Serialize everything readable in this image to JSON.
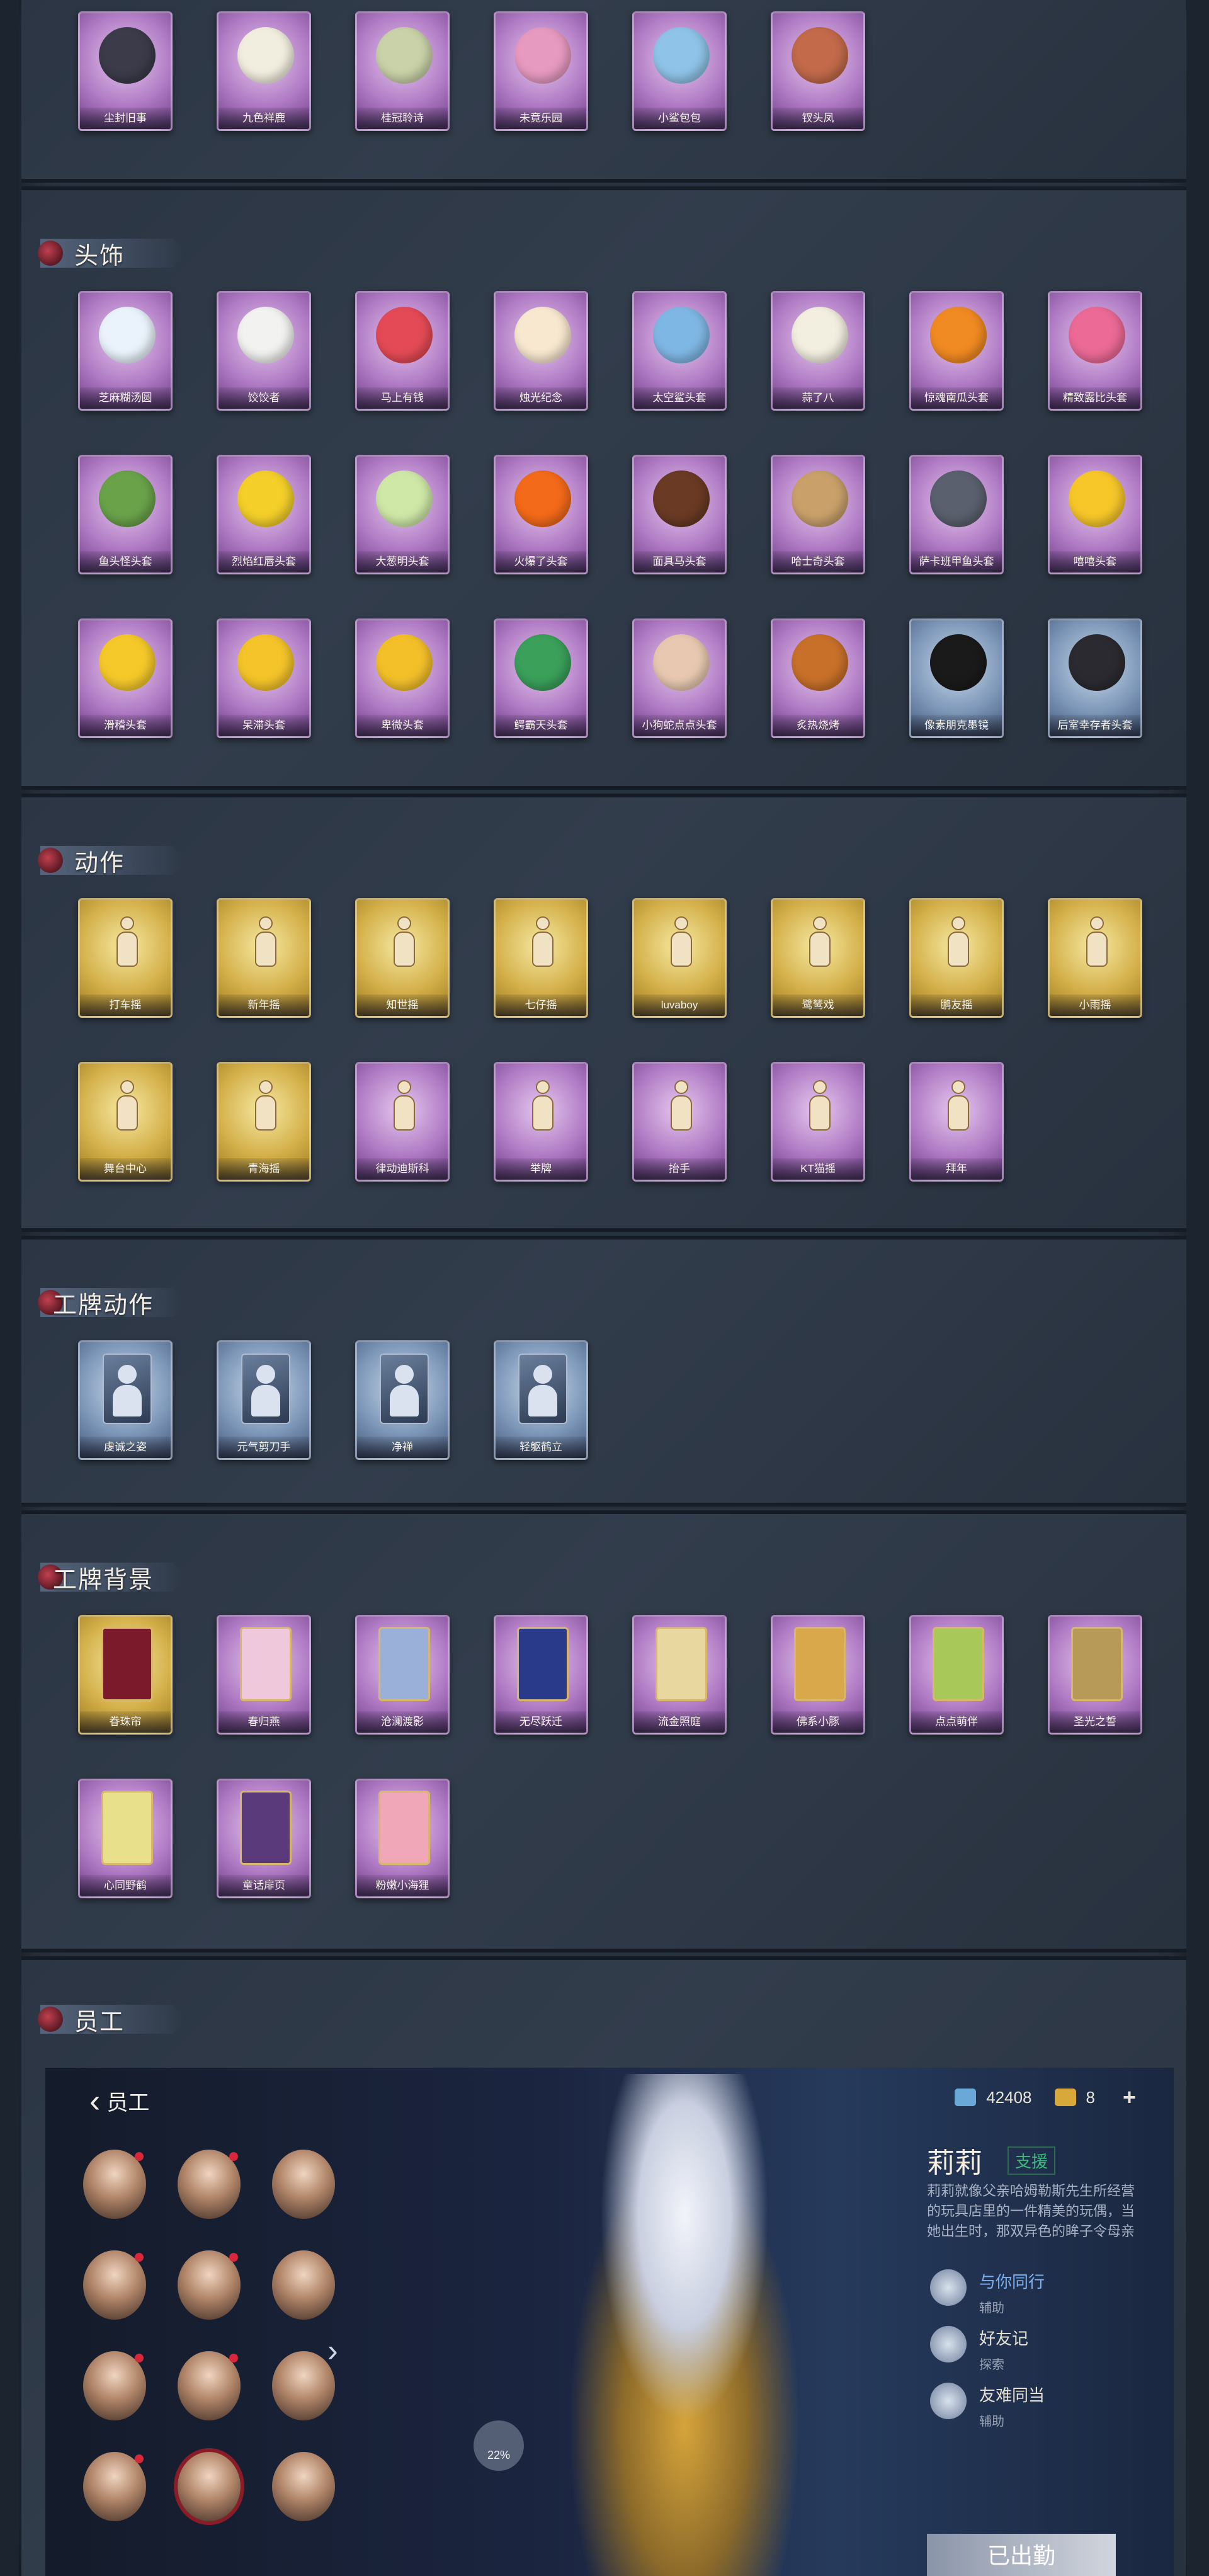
{
  "sections": {
    "s0": {
      "items": [
        {
          "label": "尘封旧事",
          "c": "purple",
          "pc": "#3b3b4a"
        },
        {
          "label": "九色祥鹿",
          "c": "purple",
          "pc": "#f1eedf"
        },
        {
          "label": "桂冠聆诗",
          "c": "purple",
          "pc": "#c9d2a8"
        },
        {
          "label": "未竟乐园",
          "c": "purple",
          "pc": "#e79ac0"
        },
        {
          "label": "小鲨包包",
          "c": "purple",
          "pc": "#8fc3e8"
        },
        {
          "label": "钗头凤",
          "c": "purple",
          "pc": "#c26a4a"
        }
      ]
    },
    "s1": {
      "title": "头饰",
      "items": [
        {
          "label": "芝麻糊汤圆",
          "c": "purple",
          "pc": "#eaf3fb"
        },
        {
          "label": "饺饺者",
          "c": "purple",
          "pc": "#f2f2f0"
        },
        {
          "label": "马上有钱",
          "c": "purple",
          "pc": "#e44a55"
        },
        {
          "label": "烛光纪念",
          "c": "purple",
          "pc": "#f8e8d0"
        },
        {
          "label": "太空鲨头套",
          "c": "purple",
          "pc": "#7fb7e4"
        },
        {
          "label": "蒜了八",
          "c": "purple",
          "pc": "#f2eee0"
        },
        {
          "label": "惊魂南瓜头套",
          "c": "purple",
          "pc": "#f08a22"
        },
        {
          "label": "精致露比头套",
          "c": "purple",
          "pc": "#ec6a96"
        },
        {
          "label": "鱼头怪头套",
          "c": "purple",
          "pc": "#6aa24a"
        },
        {
          "label": "烈焰红唇头套",
          "c": "purple",
          "pc": "#f4cf2a"
        },
        {
          "label": "大葱明头套",
          "c": "purple",
          "pc": "#cfe8a8"
        },
        {
          "label": "火爆了头套",
          "c": "purple",
          "pc": "#f36a1a"
        },
        {
          "label": "面具马头套",
          "c": "purple",
          "pc": "#6a3a24"
        },
        {
          "label": "哈士奇头套",
          "c": "purple",
          "pc": "#c9a06a"
        },
        {
          "label": "萨卡班甲鱼头套",
          "c": "purple",
          "pc": "#5a606e"
        },
        {
          "label": "嘻嘻头套",
          "c": "purple",
          "pc": "#f7c72a"
        },
        {
          "label": "滑稽头套",
          "c": "purple",
          "pc": "#f5c92a"
        },
        {
          "label": "呆滞头套",
          "c": "purple",
          "pc": "#f4c42a"
        },
        {
          "label": "卑微头套",
          "c": "purple",
          "pc": "#f3c02a"
        },
        {
          "label": "鳄霸天头套",
          "c": "purple",
          "pc": "#3aa05a"
        },
        {
          "label": "小狗蛇点点头套",
          "c": "purple",
          "pc": "#e8c8b0"
        },
        {
          "label": "炙热烧烤",
          "c": "purple",
          "pc": "#c8702a"
        },
        {
          "label": "像素朋克墨镜",
          "c": "blue",
          "pc": "#1a1a1a"
        },
        {
          "label": "后室幸存者头套",
          "c": "blue",
          "pc": "#2a2a30"
        }
      ]
    },
    "s2": {
      "title": "动作",
      "items": [
        {
          "label": "打车摇",
          "c": "gold"
        },
        {
          "label": "新年摇",
          "c": "gold"
        },
        {
          "label": "知世摇",
          "c": "gold"
        },
        {
          "label": "七仔摇",
          "c": "gold"
        },
        {
          "label": "luvaboy",
          "c": "gold"
        },
        {
          "label": "鹭鸶戏",
          "c": "gold"
        },
        {
          "label": "鹏友摇",
          "c": "gold"
        },
        {
          "label": "小雨摇",
          "c": "gold"
        },
        {
          "label": "舞台中心",
          "c": "gold"
        },
        {
          "label": "青海摇",
          "c": "gold"
        },
        {
          "label": "律动迪斯科",
          "c": "purple"
        },
        {
          "label": "举牌",
          "c": "purple"
        },
        {
          "label": "抬手",
          "c": "purple"
        },
        {
          "label": "KT猫摇",
          "c": "purple"
        },
        {
          "label": "拜年",
          "c": "purple"
        }
      ]
    },
    "s3": {
      "title": "工牌动作",
      "items": [
        {
          "label": "虔诚之姿",
          "c": "blue"
        },
        {
          "label": "元气剪刀手",
          "c": "blue"
        },
        {
          "label": "净禅",
          "c": "blue"
        },
        {
          "label": "轻躯鹤立",
          "c": "blue"
        }
      ]
    },
    "s4": {
      "title": "工牌背景",
      "items": [
        {
          "label": "眷珠帘",
          "c": "gold",
          "pc": "#7a1a2a"
        },
        {
          "label": "春归燕",
          "c": "purple",
          "pc": "#f0c8dc"
        },
        {
          "label": "沧澜渡影",
          "c": "purple",
          "pc": "#9ab0d8"
        },
        {
          "label": "无尽跃迁",
          "c": "purple",
          "pc": "#2a3a8a"
        },
        {
          "label": "流金照庭",
          "c": "purple",
          "pc": "#e8d8a0"
        },
        {
          "label": "佛系小豚",
          "c": "purple",
          "pc": "#d8a84a"
        },
        {
          "label": "点点萌伴",
          "c": "purple",
          "pc": "#a8c85a"
        },
        {
          "label": "圣光之誓",
          "c": "purple",
          "pc": "#b89a58"
        },
        {
          "label": "心同野鹤",
          "c": "purple",
          "pc": "#e8e08a"
        },
        {
          "label": "童话扉页",
          "c": "purple",
          "pc": "#5a3a7a"
        },
        {
          "label": "粉嫩小海狸",
          "c": "purple",
          "pc": "#f0a8b8"
        }
      ]
    },
    "s5": {
      "title": "员工"
    }
  },
  "game": {
    "back_label": "员工",
    "currency": [
      {
        "value": "42408",
        "color": "#6aa8d8"
      },
      {
        "value": "8",
        "color": "#d8a83a"
      }
    ],
    "plus": "+",
    "arrow": "›",
    "badge": "22%",
    "char_name": "莉莉",
    "char_role": "支援",
    "char_desc": "莉莉就像父亲哈姆勒斯先生所经营的玩具店里的一件精美的玩偶，当她出生时，那双异色的眸子令母亲",
    "traits": [
      {
        "title": "与你同行",
        "sub": "辅助",
        "hl": true
      },
      {
        "title": "好友记",
        "sub": "探索",
        "hl": false
      },
      {
        "title": "友难同当",
        "sub": "辅助",
        "hl": false
      }
    ],
    "button": "已出勤"
  }
}
